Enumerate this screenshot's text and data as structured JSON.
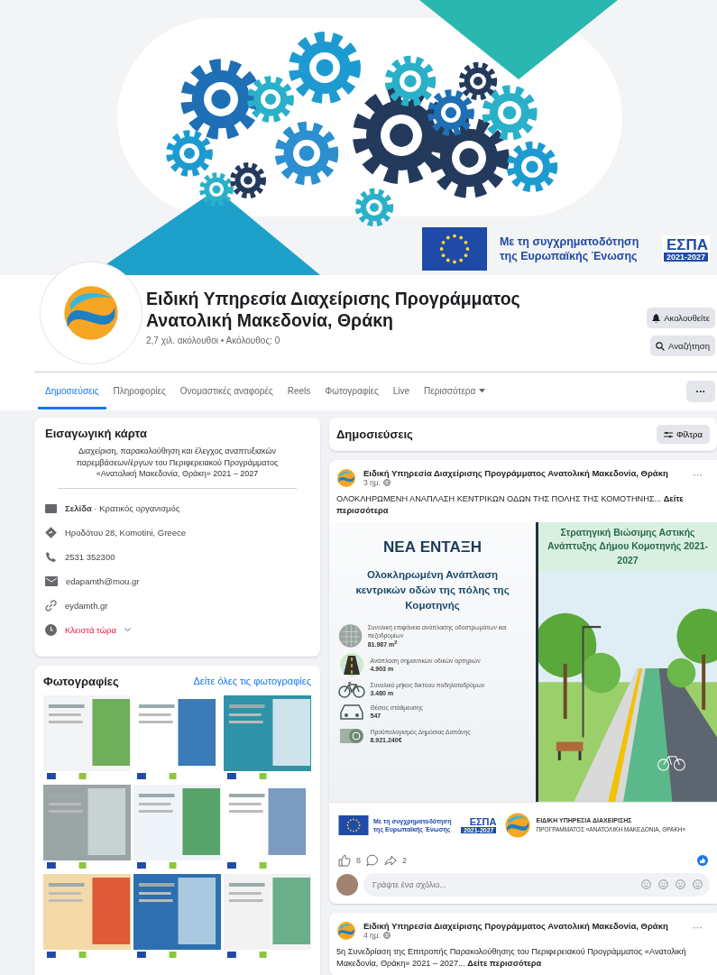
{
  "cover": {
    "cofunding": "Με τη συγχρηματοδότηση της Ευρωπαϊκής Ένωσης",
    "espa": "ΕΣΠΑ",
    "espa_years": "2021-2027"
  },
  "page": {
    "name": "Ειδική Υπηρεσία Διαχείρισης Προγράμματος Ανατολική Μακεδονία, Θράκη",
    "stats": "2,7 χιλ. ακόλουθοι • Ακόλουθος: 0"
  },
  "actions": [
    {
      "kind": "follow",
      "label": "Ακολουθείτε"
    },
    {
      "kind": "search",
      "label": "Αναζήτηση"
    }
  ],
  "tabs": [
    {
      "label": "Δημοσιεύσεις",
      "selected": true
    },
    {
      "label": "Πληροφορίες",
      "selected": false
    },
    {
      "label": "Ονομαστικές αναφορές",
      "selected": false
    },
    {
      "label": "Reels",
      "selected": false
    },
    {
      "label": "Φωτογραφίες",
      "selected": false
    },
    {
      "label": "Live",
      "selected": false
    },
    {
      "label": "Περισσότερα",
      "selected": false,
      "menu": true
    }
  ],
  "more_button": "···",
  "intro": {
    "title": "Εισαγωγική κάρτα",
    "bio": "Διαχείριση, παρακολούθηση και έλεγχος αναπτυξιακών παρεμβάσεων/έργων του Περιφερειακού Προγράμματος «Ανατολική Μακεδονία, Θράκη» 2021 – 2027",
    "details": [
      {
        "kind": "category",
        "text": "**Σελίδα** · Κρατικός οργανισμός"
      },
      {
        "kind": "address",
        "text": "Ηροδότου 28, Komotini, Greece"
      },
      {
        "kind": "phone",
        "text": "2531 352300"
      },
      {
        "kind": "email",
        "text": "edapamth@mou.gr"
      },
      {
        "kind": "website",
        "text": "eydamth.gr"
      },
      {
        "kind": "hours",
        "text": "Κλειστά τώρα"
      }
    ]
  },
  "photos": {
    "title": "Φωτογραφίες",
    "link": "Δείτε όλες τις φωτογραφίες"
  },
  "posts_header": {
    "title": "Δημοσιεύσεις",
    "filter": "Φίλτρα"
  },
  "posts": [
    {
      "author": "Ειδική Υπηρεσία Διαχείρισης Προγράμματος Ανατολική Μακεδονία, Θράκη",
      "time": "3 ημ.",
      "text": "ΟΛΟΚΛΗΡΩΜΕΝΗ ΑΝΑΠΛΑΣΗ ΚΕΝΤΡΙΚΩΝ ΟΔΩΝ ΤΗΣ ΠΟΛΗΣ ΤΗΣ ΚΟΜΟΤΗΝΗΣ... **Δείτε περισσότερα**",
      "poster": {
        "badge": "ΝΕΑ ΕΝΤΑΞΗ",
        "title": "Ολοκληρωμένη Ανάπλαση κεντρικών οδών της πόλης της Κομοτηνής",
        "stats": [
          {
            "kind": "surface",
            "label": "Συνολική επιφάνεια ανάπλασης οδοστρωμάτων και πεζοδρομίων",
            "value": "81.987 m$^{2}$"
          },
          {
            "kind": "road",
            "label": "Ανάπλαση σημαντικών οδικών αρτηριών",
            "value": "4.903 m"
          },
          {
            "kind": "bike",
            "label": "Συνολικό μήκος δικτύου ποδηλατοδρόμων",
            "value": "3.480 m"
          },
          {
            "kind": "parking",
            "label": "Θέσεις στάθμευσης",
            "value": "547"
          },
          {
            "kind": "budget",
            "label": "Προϋπολογισμός Δημόσιας Δαπάνης",
            "value": "8.921.240€"
          }
        ],
        "strategy": "Στρατηγική Βιώσιμης Αστικής Ανάπτυξης Δήμου Κομοτηνής 2021-2027",
        "cofunding": "Με τη συγχρηματοδότηση της Ευρωπαϊκής Ένωσης",
        "espa": "ΕΣΠΑ",
        "espa_years": "2021-2027",
        "agency_line1": "ΕΙΔΙΚΗ ΥΠΗΡΕΣΙΑ ΔΙΑΧΕΙΡΙΣΗΣ",
        "agency_line2": "ΠΡΟΓΡΑΜΜΑΤΟΣ «ΑΝΑΤΟΛΙΚΗ ΜΑΚΕΔΟΝΙΑ, ΘΡΑΚΗ»"
      },
      "likes": "8",
      "shares": "2",
      "comment_placeholder": "Γράψτε ένα σχόλιο..."
    },
    {
      "author": "Ειδική Υπηρεσία Διαχείρισης Προγράμματος Ανατολική Μακεδονία, Θράκη",
      "time": "4 ημ.",
      "text": "5η Συνεδρίαση της Επιτροπής Παρακολούθησης του Περιφερειακού Προγράμματος «Ανατολική Μακεδονία, Θράκη» 2021 – 2027... **Δείτε περισσότερα**"
    }
  ]
}
